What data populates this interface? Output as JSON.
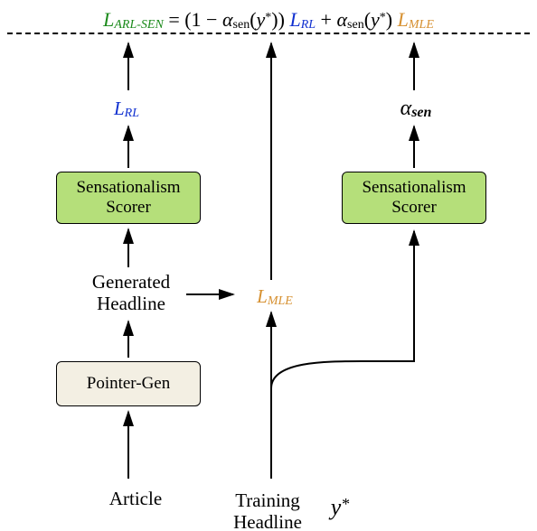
{
  "equation": {
    "lhs_L": "L",
    "lhs_sub": "ARL-SEN",
    "eq": " = ",
    "open": "(1 − ",
    "alpha": "α",
    "alpha_sub": "sen",
    "of_y": "(",
    "y": "y",
    "star": "*",
    "close_of": ")",
    "close_paren": ") ",
    "rl_L": "L",
    "rl_sub": "RL",
    "plus": " + ",
    "mle_L": "L",
    "mle_sub": "MLE"
  },
  "left": {
    "lrl_L": "L",
    "lrl_sub": "RL",
    "scorer": "Sensationalism\nScorer",
    "gen_headline": "Generated\nHeadline",
    "pointer_gen": "Pointer-Gen",
    "article": "Article"
  },
  "mid": {
    "lmle_L": "L",
    "lmle_sub": "MLE",
    "training": "Training\nHeadline",
    "yvar": "y",
    "ystar": "*"
  },
  "right": {
    "alpha": "α",
    "alpha_sub": "sen",
    "scorer": "Sensationalism\nScorer"
  }
}
